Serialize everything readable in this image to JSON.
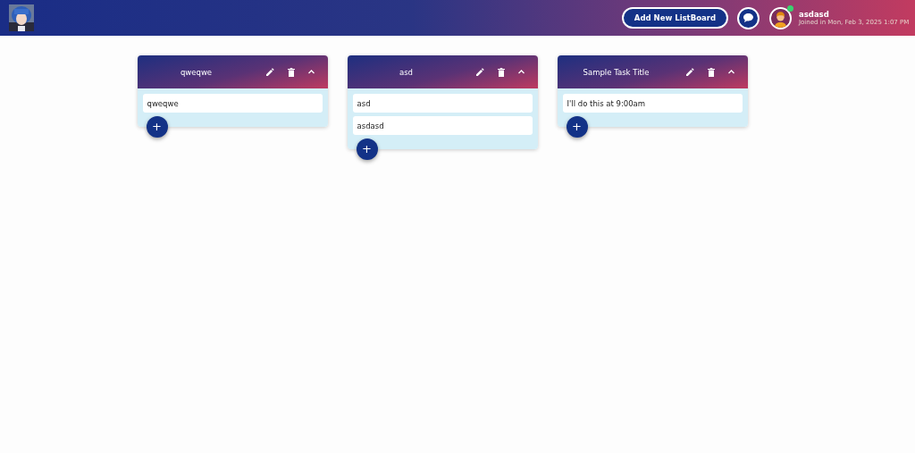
{
  "header": {
    "add_button": "Add New ListBoard",
    "user": {
      "name": "asdasd",
      "joined": "Joined in Mon, Feb 3, 2025 1:07 PM",
      "online": true
    }
  },
  "boards": [
    {
      "title": "qweqwe",
      "items": [
        "qweqwe"
      ],
      "add_label": "+"
    },
    {
      "title": "asd",
      "items": [
        "asd",
        "asdasd"
      ],
      "add_label": "+"
    },
    {
      "title": "Sample Task Title",
      "items": [
        "I'll do this at 9:00am"
      ],
      "add_label": "+"
    }
  ]
}
